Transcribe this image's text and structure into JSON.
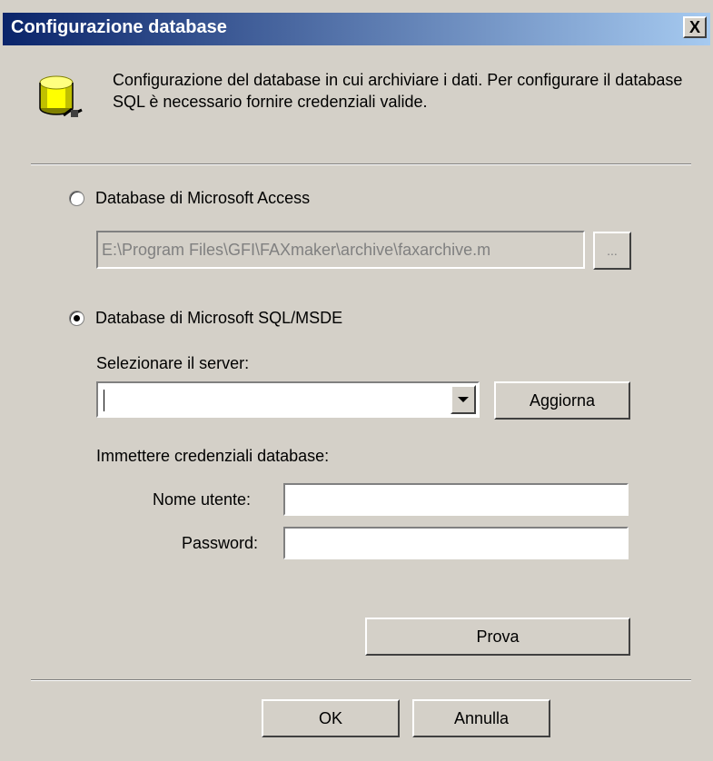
{
  "window": {
    "title": "Configurazione database",
    "close_glyph": "X"
  },
  "header": {
    "icon": "database-icon",
    "description": "Configurazione del database in cui archiviare i dati. Per configurare il database SQL è necessario fornire credenziali valide."
  },
  "access": {
    "label": "Database di Microsoft Access",
    "selected": false,
    "path_value": "E:\\Program Files\\GFI\\FAXmaker\\archive\\faxarchive.m",
    "browse_label": "..."
  },
  "sql": {
    "label": "Database di Microsoft SQL/MSDE",
    "selected": true,
    "server_label": "Selezionare il server:",
    "server_value": "",
    "refresh_label": "Aggiorna",
    "credentials_label": "Immettere credenziali database:",
    "username_label": "Nome utente:",
    "username_value": "",
    "password_label": "Password:",
    "password_value": "",
    "test_label": "Prova"
  },
  "footer": {
    "ok_label": "OK",
    "cancel_label": "Annulla"
  }
}
